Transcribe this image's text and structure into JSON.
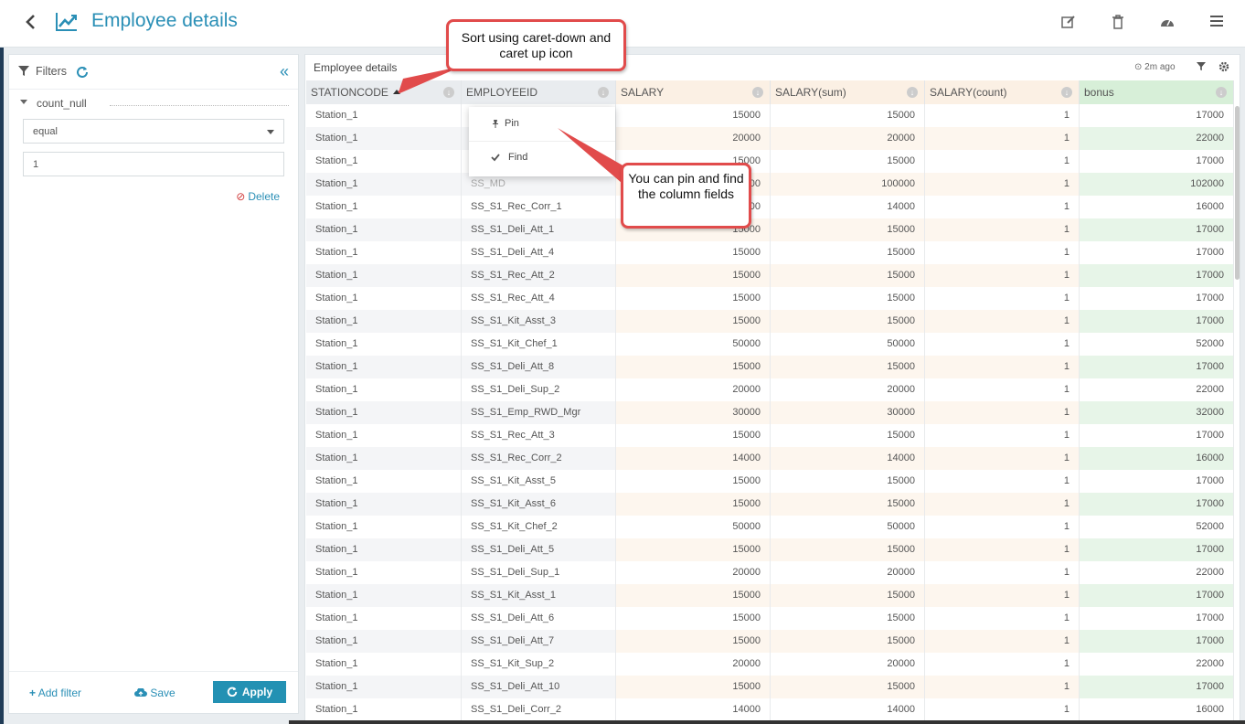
{
  "header": {
    "title": "Employee details",
    "back_icon": "chevron-left-icon",
    "app_icon": "line-chart-icon",
    "actions": [
      "edit-icon",
      "trash-icon",
      "dashboard-icon",
      "menu-icon"
    ]
  },
  "filters": {
    "title": "Filters",
    "field": "count_null",
    "operator": "equal",
    "value": "1",
    "delete_label": "Delete",
    "add_filter_label": "Add filter",
    "save_label": "Save",
    "apply_label": "Apply"
  },
  "grid": {
    "title": "Employee details",
    "updated": "2m ago",
    "columns": [
      "STATIONCODE",
      "EMPLOYEEID",
      "SALARY",
      "SALARY(sum)",
      "SALARY(count)",
      "bonus"
    ],
    "column_colors": [
      "#e9ecef",
      "#e9ecef",
      "#fbf0e4",
      "#fbf0e4",
      "#fbf0e4",
      "#d7efd8"
    ],
    "rows": [
      [
        "Station_1",
        "",
        "15000",
        "15000",
        "1",
        "17000"
      ],
      [
        "Station_1",
        "",
        "20000",
        "20000",
        "1",
        "22000"
      ],
      [
        "Station_1",
        "",
        "15000",
        "15000",
        "1",
        "17000"
      ],
      [
        "Station_1",
        "SS_MD",
        "100000",
        "100000",
        "1",
        "102000"
      ],
      [
        "Station_1",
        "SS_S1_Rec_Corr_1",
        "14000",
        "14000",
        "1",
        "16000"
      ],
      [
        "Station_1",
        "SS_S1_Deli_Att_1",
        "15000",
        "15000",
        "1",
        "17000"
      ],
      [
        "Station_1",
        "SS_S1_Deli_Att_4",
        "15000",
        "15000",
        "1",
        "17000"
      ],
      [
        "Station_1",
        "SS_S1_Rec_Att_2",
        "15000",
        "15000",
        "1",
        "17000"
      ],
      [
        "Station_1",
        "SS_S1_Rec_Att_4",
        "15000",
        "15000",
        "1",
        "17000"
      ],
      [
        "Station_1",
        "SS_S1_Kit_Asst_3",
        "15000",
        "15000",
        "1",
        "17000"
      ],
      [
        "Station_1",
        "SS_S1_Kit_Chef_1",
        "50000",
        "50000",
        "1",
        "52000"
      ],
      [
        "Station_1",
        "SS_S1_Deli_Att_8",
        "15000",
        "15000",
        "1",
        "17000"
      ],
      [
        "Station_1",
        "SS_S1_Deli_Sup_2",
        "20000",
        "20000",
        "1",
        "22000"
      ],
      [
        "Station_1",
        "SS_S1_Emp_RWD_Mgr",
        "30000",
        "30000",
        "1",
        "32000"
      ],
      [
        "Station_1",
        "SS_S1_Rec_Att_3",
        "15000",
        "15000",
        "1",
        "17000"
      ],
      [
        "Station_1",
        "SS_S1_Rec_Corr_2",
        "14000",
        "14000",
        "1",
        "16000"
      ],
      [
        "Station_1",
        "SS_S1_Kit_Asst_5",
        "15000",
        "15000",
        "1",
        "17000"
      ],
      [
        "Station_1",
        "SS_S1_Kit_Asst_6",
        "15000",
        "15000",
        "1",
        "17000"
      ],
      [
        "Station_1",
        "SS_S1_Kit_Chef_2",
        "50000",
        "50000",
        "1",
        "52000"
      ],
      [
        "Station_1",
        "SS_S1_Deli_Att_5",
        "15000",
        "15000",
        "1",
        "17000"
      ],
      [
        "Station_1",
        "SS_S1_Deli_Sup_1",
        "20000",
        "20000",
        "1",
        "22000"
      ],
      [
        "Station_1",
        "SS_S1_Kit_Asst_1",
        "15000",
        "15000",
        "1",
        "17000"
      ],
      [
        "Station_1",
        "SS_S1_Deli_Att_6",
        "15000",
        "15000",
        "1",
        "17000"
      ],
      [
        "Station_1",
        "SS_S1_Deli_Att_7",
        "15000",
        "15000",
        "1",
        "17000"
      ],
      [
        "Station_1",
        "SS_S1_Kit_Sup_2",
        "20000",
        "20000",
        "1",
        "22000"
      ],
      [
        "Station_1",
        "SS_S1_Deli_Att_10",
        "15000",
        "15000",
        "1",
        "17000"
      ],
      [
        "Station_1",
        "SS_S1_Deli_Corr_2",
        "14000",
        "14000",
        "1",
        "16000"
      ]
    ]
  },
  "context_menu": {
    "pin_label": "Pin",
    "find_label": "Find"
  },
  "callouts": {
    "sort": "Sort using caret-down and caret up icon",
    "pin_find": "You can pin and find the column fields"
  }
}
